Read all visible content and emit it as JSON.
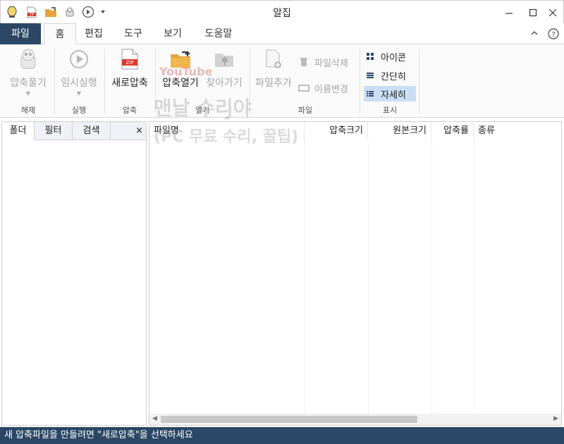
{
  "window": {
    "title": "알집"
  },
  "quick_access": [
    "alzip-logo-icon",
    "zip-file-icon",
    "open-folder-icon",
    "extract-icon",
    "run-icon",
    "customize-dropdown-icon"
  ],
  "ribbon_tabs": [
    {
      "label": "파일"
    },
    {
      "label": "홈"
    },
    {
      "label": "편집"
    },
    {
      "label": "도구"
    },
    {
      "label": "보기"
    },
    {
      "label": "도움말"
    }
  ],
  "ribbon": {
    "groups": [
      {
        "label": "해제"
      },
      {
        "label": "실행"
      },
      {
        "label": "압축"
      },
      {
        "label": "열기"
      },
      {
        "label": "파일"
      },
      {
        "label": "표시"
      }
    ],
    "buttons": {
      "extract": "압축풀기",
      "temp_run": "임시실행",
      "new_archive": "새로압축",
      "open_archive": "압축열기",
      "find": "찾아가기",
      "add_file": "파일추가",
      "delete_file": "파일삭제",
      "rename": "이름변경",
      "view_icons": "아이콘",
      "view_simple": "간단히",
      "view_detail": "자세히"
    }
  },
  "watermark": {
    "line1": "맨날 수리야",
    "line2": "(PC 무료 수리, 꿀팁)",
    "brand": "YouTube"
  },
  "left_panel": {
    "tabs": [
      "폴더",
      "필터",
      "검색"
    ],
    "close": "×"
  },
  "file_list": {
    "columns": [
      "파일명",
      "압축크기",
      "원본크기",
      "압축률",
      "종류"
    ],
    "rows": []
  },
  "status": {
    "message": "새 압축파일을 만들려면 \"새로압축\"을 선택하세요"
  },
  "colors": {
    "accent": "#2b4765",
    "selected": "#c9def5",
    "zip_red": "#d9392b",
    "folder_orange": "#e8a33d"
  }
}
